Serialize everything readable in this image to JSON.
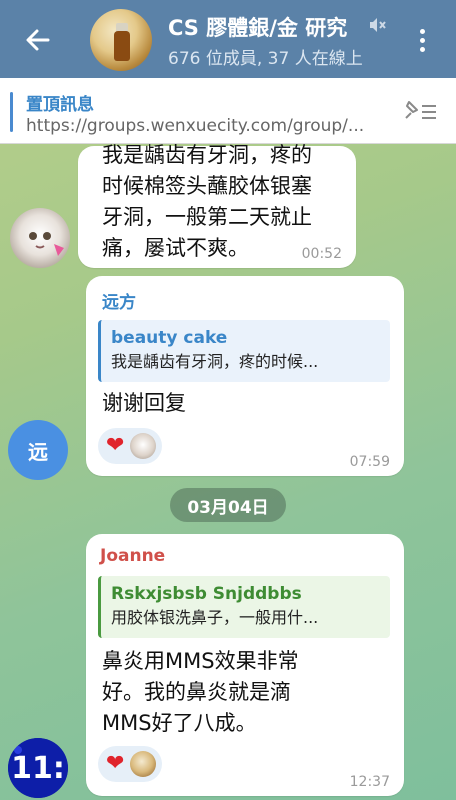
{
  "header": {
    "title": "CS 膠體銀/金 研究",
    "subtitle": "676 位成員, 37 人在線上"
  },
  "pinned": {
    "label": "置頂訊息",
    "text": "https://groups.wenxuecity.com/group/..."
  },
  "messages": [
    {
      "text": "我是龋齿有牙洞，疼的时候棉签头蘸胶体银塞牙洞，一般第二天就止痛，屡试不爽。",
      "lines": [
        "我是龋齿有牙洞，疼的",
        "时候棉签头蘸胶体银塞",
        "牙洞，一般第二天就止",
        "痛，屡试不爽。"
      ],
      "time": "00:52"
    },
    {
      "sender": "远方",
      "sender_color": "#3a86c8",
      "avatar_letter": "远",
      "quote": {
        "name": "beauty cake",
        "text": "我是龋齿有牙洞，疼的时候..."
      },
      "text": "谢谢回复",
      "time": "07:59"
    },
    {
      "sender": "Joanne",
      "sender_color": "#d0504a",
      "quote": {
        "name": "Rskxjsbsb Snjddbbs",
        "text": "用胶体银洗鼻子，一般用什..."
      },
      "text": "鼻炎用MMS效果非常好。我的鼻炎就是滴MMS好了八成。",
      "lines": [
        "鼻炎用MMS效果非常",
        "好。我的鼻炎就是滴",
        "MMS好了八成。"
      ],
      "time": "12:37"
    }
  ],
  "date_separator": "03月04日",
  "colors": {
    "header": "#5b82a8",
    "accent": "#3a86c8",
    "quote_green": "#4a9a40"
  }
}
